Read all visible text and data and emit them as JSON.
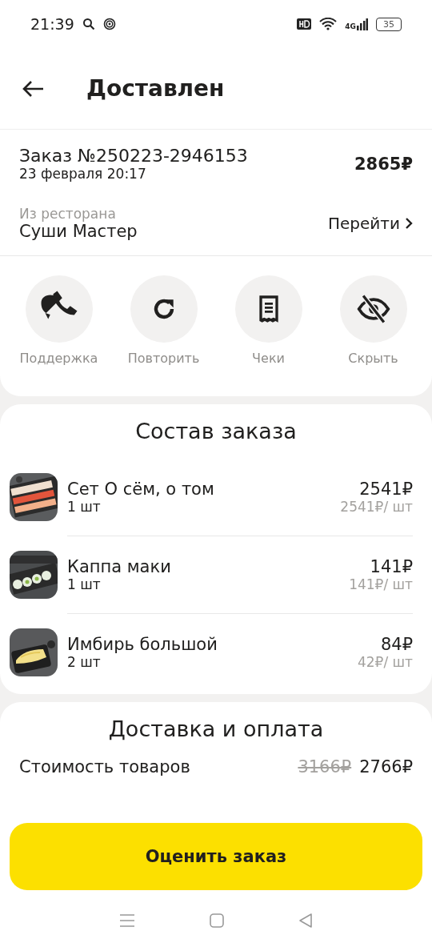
{
  "status_bar": {
    "time": "21:39",
    "battery": "35",
    "network": "4G"
  },
  "header": {
    "title": "Доставлен"
  },
  "order": {
    "number": "Заказ №250223-2946153",
    "date": "23 февраля 20:17",
    "total": "2865₽",
    "restaurant_label": "Из ресторана",
    "restaurant": "Суши Мастер",
    "go_link": "Перейти"
  },
  "actions": [
    {
      "kind": "support",
      "label": "Поддержка"
    },
    {
      "kind": "repeat",
      "label": "Повторить"
    },
    {
      "kind": "receipt",
      "label": "Чеки"
    },
    {
      "kind": "hide",
      "label": "Скрыть"
    }
  ],
  "composition": {
    "title": "Состав заказа",
    "items": [
      {
        "name": "Сет О сём, о том",
        "qty": "1 шт",
        "price": "2541₽",
        "unit_price": "2541₽/ шт"
      },
      {
        "name": "Каппа маки",
        "qty": "1 шт",
        "price": "141₽",
        "unit_price": "141₽/ шт"
      },
      {
        "name": "Имбирь большой",
        "qty": "2 шт",
        "price": "84₽",
        "unit_price": "42₽/ шт"
      }
    ]
  },
  "delivery": {
    "title": "Доставка и оплата",
    "rows": [
      {
        "label": "Стоимость товаров",
        "old_value": "3166₽",
        "value": "2766₽"
      }
    ]
  },
  "rate_button": "Оценить заказ"
}
